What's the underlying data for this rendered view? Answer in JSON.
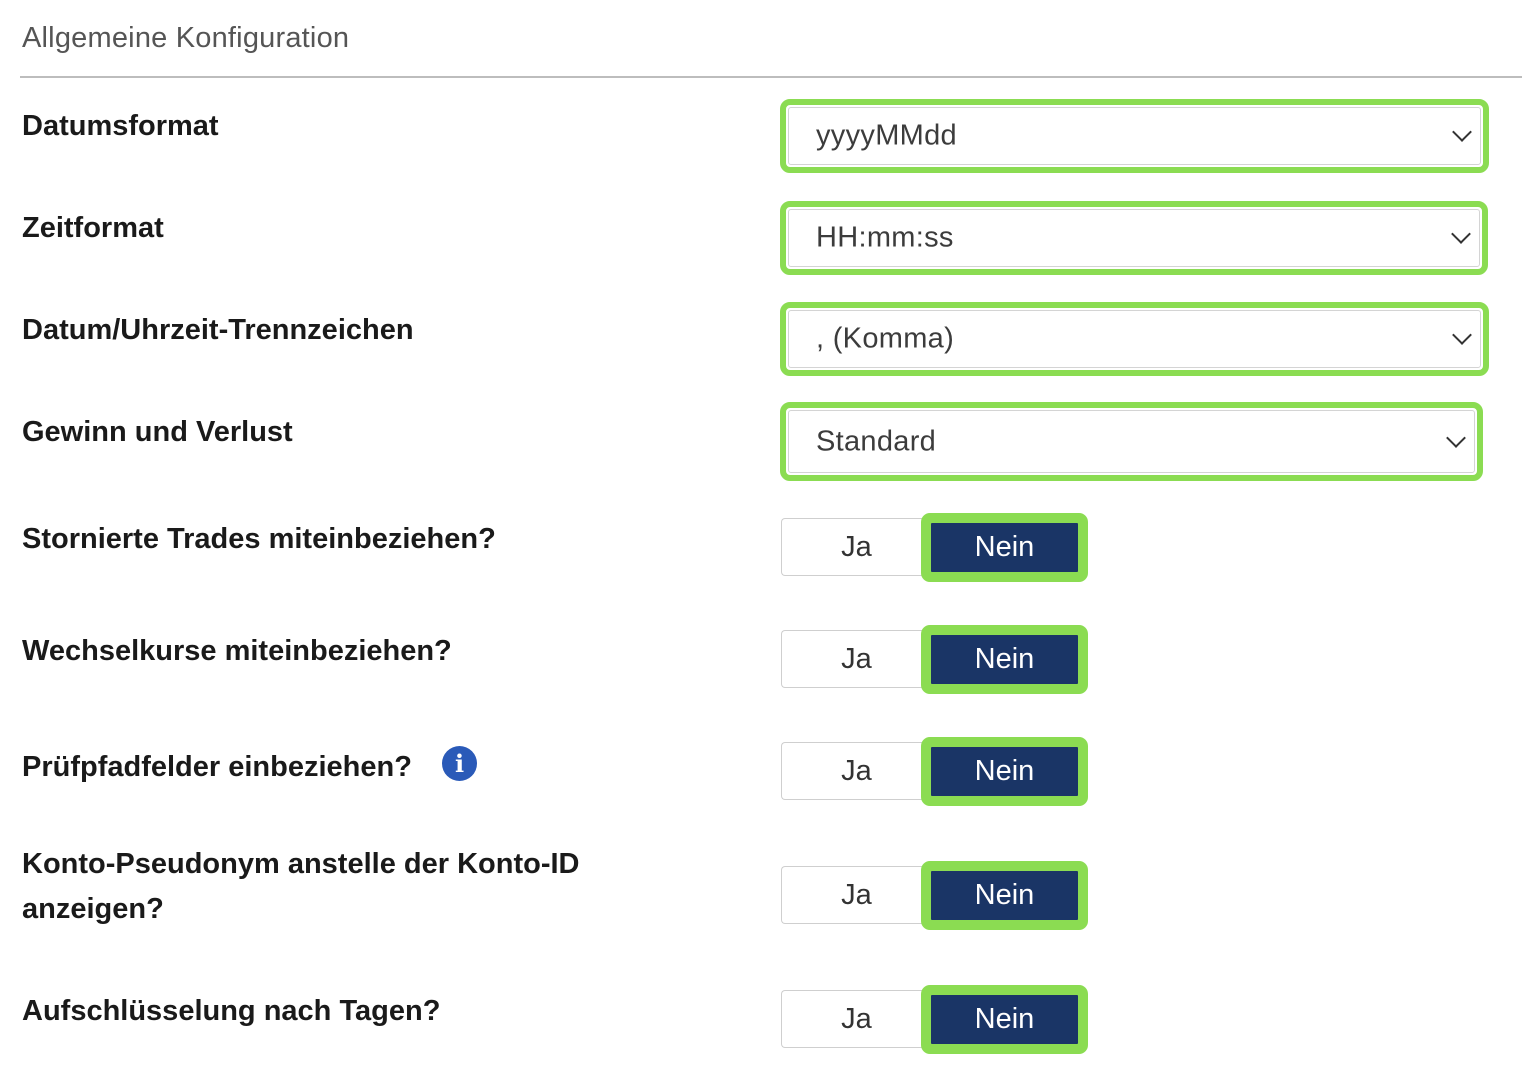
{
  "section": {
    "title": "Allgemeine Konfiguration"
  },
  "selects": [
    {
      "label": "Datumsformat",
      "value": "yyyyMMdd"
    },
    {
      "label": "Zeitformat",
      "value": "HH:mm:ss"
    },
    {
      "label": "Datum/Uhrzeit-Trennzeichen",
      "value": ", (Komma)"
    },
    {
      "label": "Gewinn und Verlust",
      "value": "Standard"
    }
  ],
  "toggles": [
    {
      "label": "Stornierte Trades miteinbeziehen?",
      "yes": "Ja",
      "no": "Nein",
      "selected": "Nein"
    },
    {
      "label": "Wechselkurse miteinbeziehen?",
      "yes": "Ja",
      "no": "Nein",
      "selected": "Nein"
    },
    {
      "label": "Prüfpfadfelder einbeziehen?",
      "yes": "Ja",
      "no": "Nein",
      "selected": "Nein",
      "info_icon": "info-icon"
    },
    {
      "label": "Konto-Pseudonym anstelle der Konto-ID anzeigen?",
      "yes": "Ja",
      "no": "Nein",
      "selected": "Nein"
    },
    {
      "label": "Aufschlüsselung nach Tagen?",
      "yes": "Ja",
      "no": "Nein",
      "selected": "Nein"
    }
  ],
  "colors": {
    "highlight": "#8bdc52",
    "selected_toggle": "#1a3566",
    "info_icon": "#2a5ab8"
  }
}
